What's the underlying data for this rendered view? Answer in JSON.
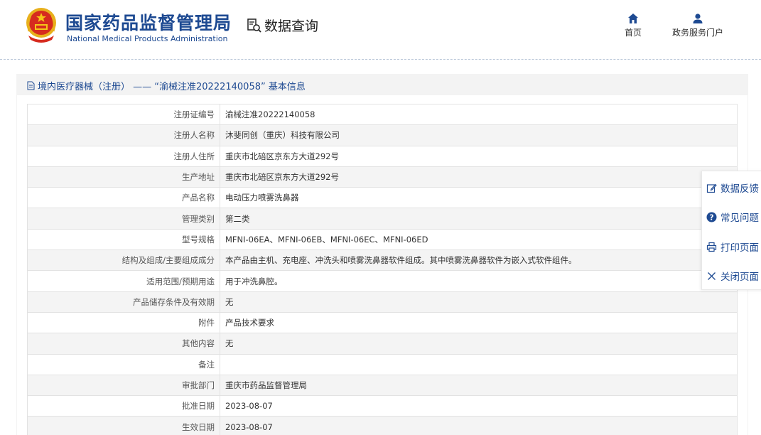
{
  "header": {
    "brand_cn": "国家药品监督管理局",
    "brand_en": "National Medical Products Administration",
    "query_label": "数据查询",
    "nav": {
      "home_label": "首页",
      "portal_label": "政务服务门户"
    }
  },
  "panel": {
    "title": "境内医疗器械（注册） —— “渝械注准20222140058” 基本信息"
  },
  "details": [
    {
      "label": "注册证编号",
      "value": "渝械注准20222140058"
    },
    {
      "label": "注册人名称",
      "value": "沐斐同创（重庆）科技有限公司"
    },
    {
      "label": "注册人住所",
      "value": "重庆市北碚区京东方大道292号"
    },
    {
      "label": "生产地址",
      "value": "重庆市北碚区京东方大道292号"
    },
    {
      "label": "产品名称",
      "value": "电动压力喷雾洗鼻器"
    },
    {
      "label": "管理类别",
      "value": "第二类"
    },
    {
      "label": "型号规格",
      "value": "MFNI-06EA、MFNI-06EB、MFNI-06EC、MFNI-06ED"
    },
    {
      "label": "结构及组成/主要组成成分",
      "value": "本产品由主机、充电座、冲洗头和喷雾洗鼻器软件组成。其中喷雾洗鼻器软件为嵌入式软件组件。"
    },
    {
      "label": "适用范围/预期用途",
      "value": "用于冲洗鼻腔。"
    },
    {
      "label": "产品储存条件及有效期",
      "value": "无"
    },
    {
      "label": "附件",
      "value": "产品技术要求"
    },
    {
      "label": "其他内容",
      "value": "无"
    },
    {
      "label": "备注",
      "value": ""
    },
    {
      "label": "审批部门",
      "value": "重庆市药品监督管理局"
    },
    {
      "label": "批准日期",
      "value": "2023-08-07"
    },
    {
      "label": "生效日期",
      "value": "2023-08-07"
    }
  ],
  "float_bar": {
    "feedback_label": "数据反馈",
    "faq_label": "常见问题",
    "print_label": "打印页面",
    "close_label": "关闭页面"
  },
  "colors": {
    "brand_blue": "#1e4a92",
    "row_alt": "#f4f4f4",
    "panel_bg": "#f3f3f3"
  }
}
